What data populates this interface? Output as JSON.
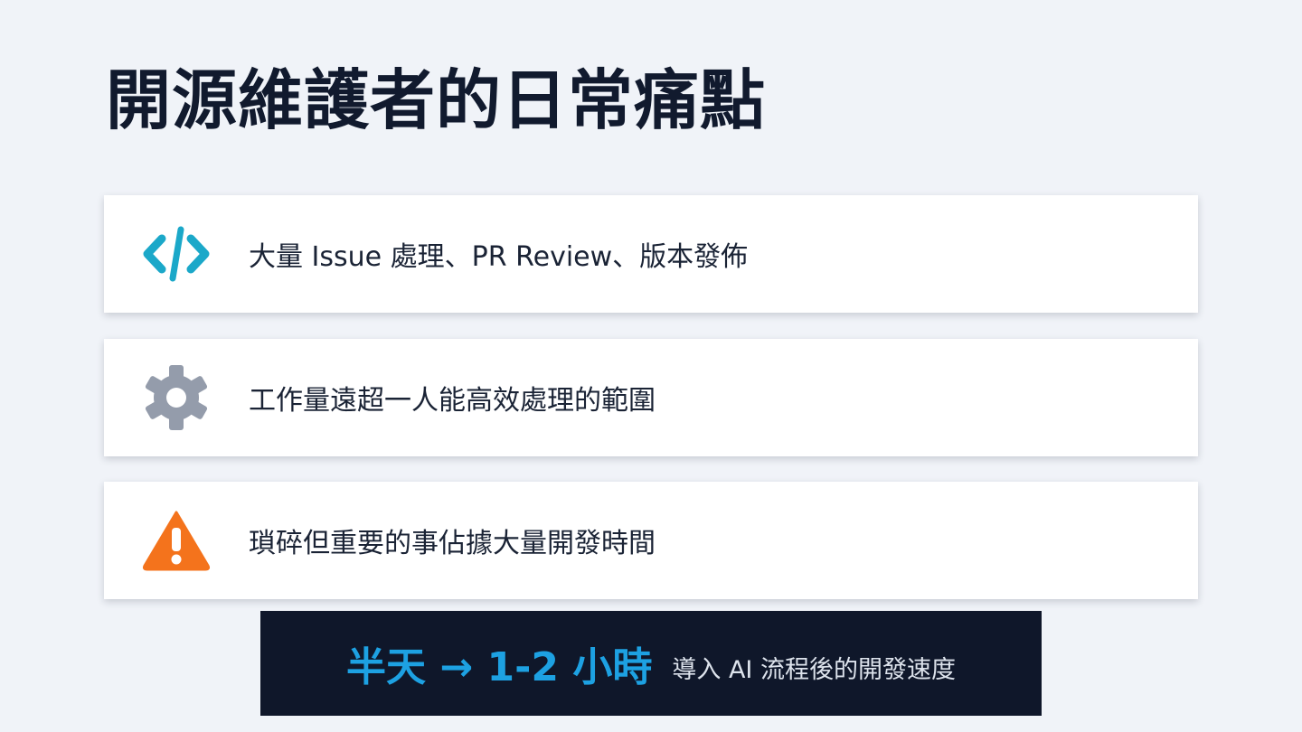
{
  "title": "開源維護者的日常痛點",
  "cards": [
    {
      "icon": "code-icon",
      "icon_color": "#1ba8c9",
      "text": "大量 Issue 處理、PR Review、版本發佈"
    },
    {
      "icon": "gear-icon",
      "icon_color": "#949cab",
      "text": "工作量遠超一人能高效處理的範圍"
    },
    {
      "icon": "warning-icon",
      "icon_color": "#f4731c",
      "text": "瑣碎但重要的事佔據大量開發時間"
    }
  ],
  "banner": {
    "highlight": "半天 → 1-2 小時",
    "caption": "導入 AI 流程後的開發速度",
    "highlight_color": "#1da1e2",
    "background": "#0f172a"
  }
}
